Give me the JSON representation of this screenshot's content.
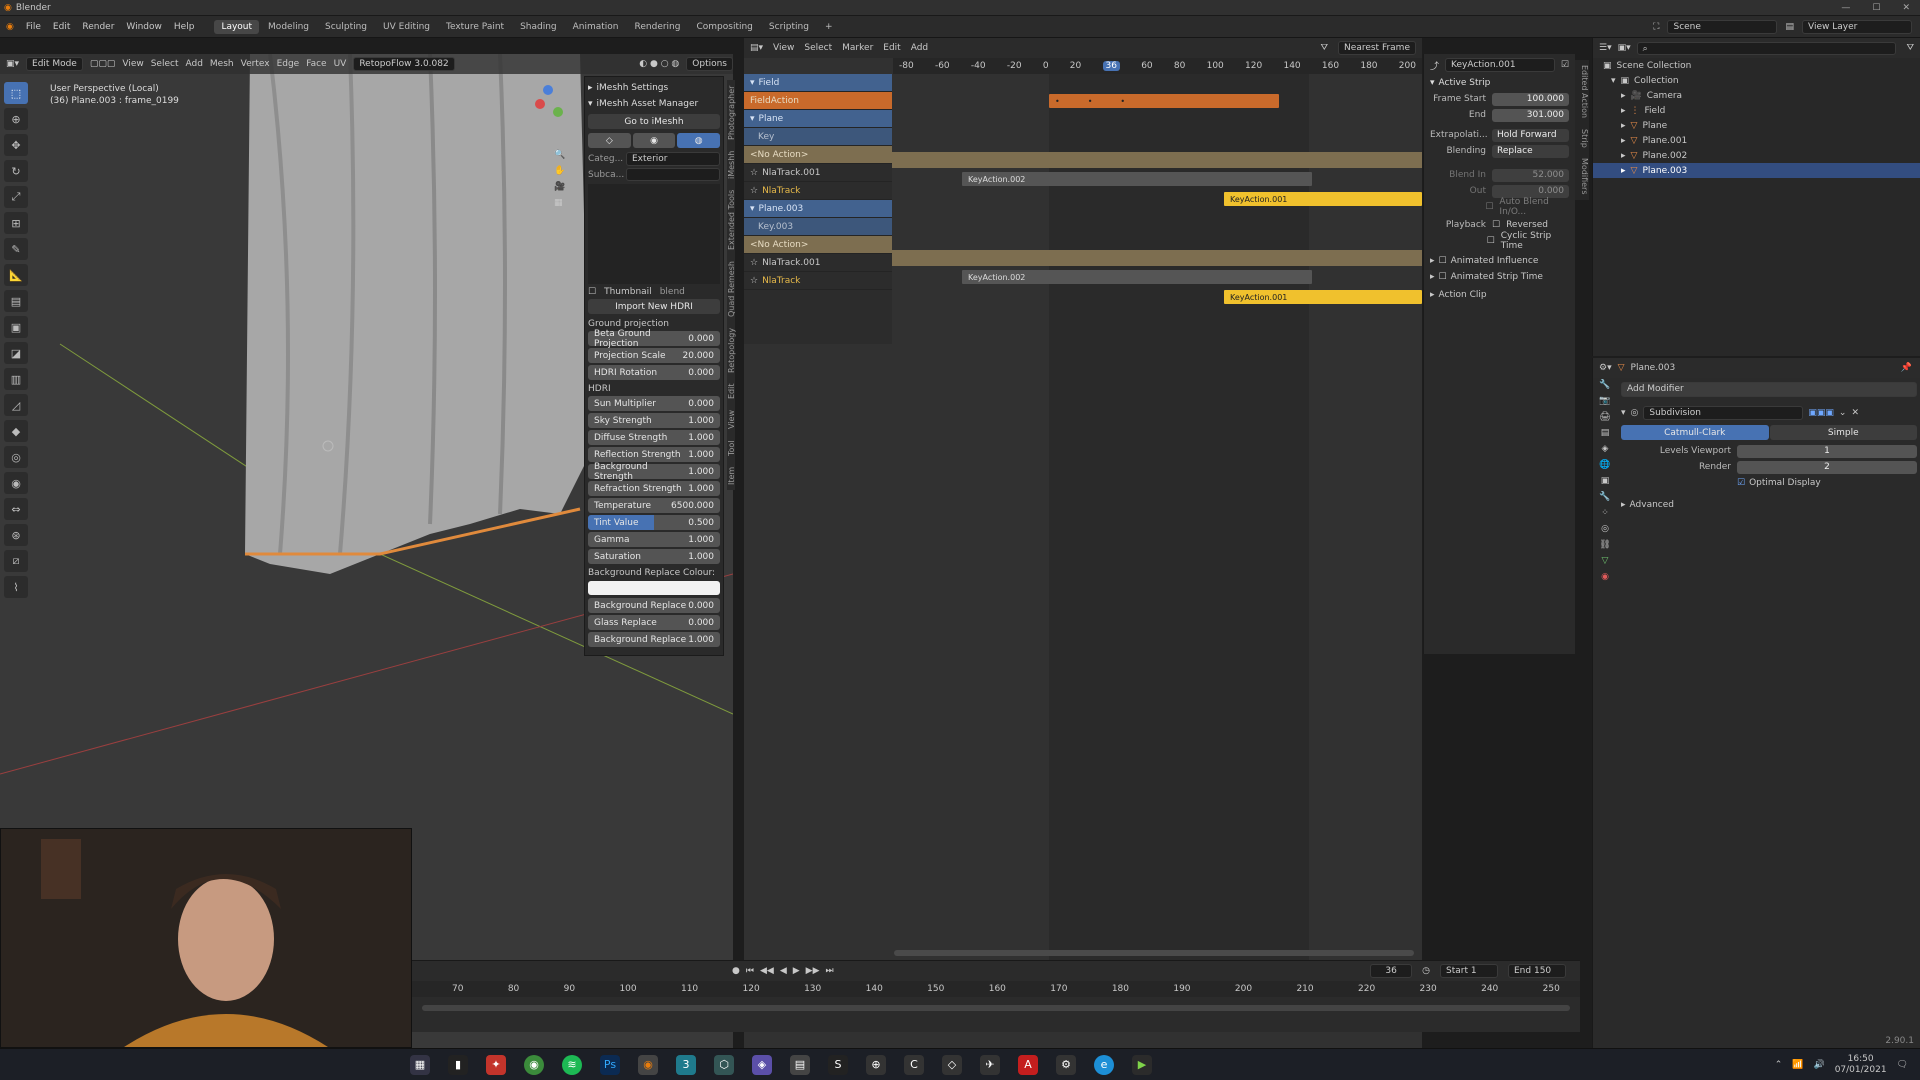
{
  "app": {
    "title": "Blender"
  },
  "menu": [
    "File",
    "Edit",
    "Render",
    "Window",
    "Help"
  ],
  "workspaces": [
    "Layout",
    "Modeling",
    "Sculpting",
    "UV Editing",
    "Texture Paint",
    "Shading",
    "Animation",
    "Rendering",
    "Compositing",
    "Scripting"
  ],
  "topright": {
    "scene": "Scene",
    "view_layer": "View Layer"
  },
  "viewport": {
    "mode": "Edit Mode",
    "menus": [
      "View",
      "Select",
      "Add",
      "Mesh",
      "Vertex",
      "Edge",
      "Face",
      "UV"
    ],
    "orientation": "Global",
    "addon": "RetopoFlow 3.0.082",
    "options": "Options",
    "overlay_title": "User Perspective (Local)",
    "overlay_sub": "(36) Plane.003 : frame_0199"
  },
  "imesh": {
    "settings": "iMeshh Settings",
    "asset_manager": "iMeshh Asset Manager",
    "goto": "Go to iMeshh",
    "category_label": "Categ...",
    "category": "Exterior",
    "subcategory_label": "Subca...",
    "thumbnail": "Thumbnail",
    "blend": "blend",
    "import": "Import New HDRI",
    "ground_heading": "Ground projection",
    "hdri_heading": "HDRI",
    "bg_replace_colour": "Background Replace Colour:",
    "fields_a": [
      {
        "label": "Beta Ground Projection",
        "value": "0.000"
      },
      {
        "label": "Projection Scale",
        "value": "20.000"
      },
      {
        "label": "HDRI Rotation",
        "value": "0.000"
      }
    ],
    "fields_b": [
      {
        "label": "Sun Multiplier",
        "value": "0.000"
      },
      {
        "label": "Sky Strength",
        "value": "1.000"
      },
      {
        "label": "Diffuse Strength",
        "value": "1.000"
      },
      {
        "label": "Reflection Strength",
        "value": "1.000"
      },
      {
        "label": "Background Strength",
        "value": "1.000"
      },
      {
        "label": "Refraction Strength",
        "value": "1.000"
      },
      {
        "label": "Temperature",
        "value": "6500.000"
      },
      {
        "label": "Tint Value",
        "value": "0.500"
      },
      {
        "label": "Gamma",
        "value": "1.000"
      },
      {
        "label": "Saturation",
        "value": "1.000"
      }
    ],
    "fields_c": [
      {
        "label": "Background Replace",
        "value": "0.000"
      },
      {
        "label": "Glass Replace",
        "value": "0.000"
      },
      {
        "label": "Background Replace",
        "value": "1.000"
      }
    ]
  },
  "side_tabs": [
    "Item",
    "Tool",
    "View",
    "Edit",
    "Retopology",
    "Quad Remesh",
    "Extended Tools",
    "iMeshh",
    "Photographer"
  ],
  "nla": {
    "menus": [
      "View",
      "Select",
      "Marker",
      "Edit",
      "Add"
    ],
    "snap": "Nearest Frame",
    "ruler": [
      "-80",
      "-60",
      "-40",
      "-20",
      "0",
      "20",
      "36",
      "60",
      "80",
      "100",
      "120",
      "140",
      "160",
      "180",
      "200"
    ],
    "tracks": [
      {
        "name": "Field",
        "kind": "obj"
      },
      {
        "name": "FieldAction",
        "kind": "act"
      },
      {
        "name": "Plane",
        "kind": "obj"
      },
      {
        "name": "Key",
        "kind": "sub"
      },
      {
        "name": "<No Action>",
        "kind": "act2"
      },
      {
        "name": "NlaTrack.001",
        "kind": "track"
      },
      {
        "name": "NlaTrack",
        "kind": "track"
      },
      {
        "name": "Plane.003",
        "kind": "obj"
      },
      {
        "name": "Key.003",
        "kind": "sub"
      },
      {
        "name": "<No Action>",
        "kind": "act2"
      },
      {
        "name": "NlaTrack.001",
        "kind": "track"
      },
      {
        "name": "NlaTrack",
        "kind": "track"
      }
    ],
    "strips": [
      "KeyAction.002",
      "KeyAction.001",
      "KeyAction.002",
      "KeyAction.001"
    ]
  },
  "strip_panel": {
    "name": "KeyAction.001",
    "heading": "Active Strip",
    "frame_start_label": "Frame Start",
    "frame_start": "100.000",
    "end_label": "End",
    "end": "301.000",
    "extrapolation_label": "Extrapolati...",
    "extrapolation": "Hold Forward",
    "blending_label": "Blending",
    "blending": "Replace",
    "blend_in_label": "Blend In",
    "blend_in": "52.000",
    "out_label": "Out",
    "out": "0.000",
    "auto_blend": "Auto Blend In/O...",
    "playback_label": "Playback",
    "reversed": "Reversed",
    "cyclic": "Cyclic Strip Time",
    "animated_influence": "Animated Influence",
    "animated_strip_time": "Animated Strip Time",
    "action_clip": "Action Clip",
    "tabs": [
      "Edited Action",
      "Strip",
      "Modifiers"
    ]
  },
  "outliner": {
    "items": [
      {
        "name": "Scene Collection",
        "indent": 0
      },
      {
        "name": "Collection",
        "indent": 1
      },
      {
        "name": "Camera",
        "indent": 2
      },
      {
        "name": "Field",
        "indent": 2
      },
      {
        "name": "Plane",
        "indent": 2
      },
      {
        "name": "Plane.001",
        "indent": 2
      },
      {
        "name": "Plane.002",
        "indent": 2
      },
      {
        "name": "Plane.003",
        "indent": 2,
        "selected": true
      }
    ]
  },
  "properties": {
    "object": "Plane.003",
    "add_modifier": "Add Modifier",
    "modifier": "Subdivision",
    "catmull": "Catmull-Clark",
    "simple": "Simple",
    "levels_label": "Levels Viewport",
    "levels": "1",
    "render_label": "Render",
    "render": "2",
    "optimal": "Optimal Display",
    "advanced": "Advanced"
  },
  "timeline": {
    "current": "36",
    "start_label": "Start",
    "start": "1",
    "end_label": "End",
    "end": "150",
    "ruler": [
      "70",
      "80",
      "90",
      "100",
      "110",
      "120",
      "130",
      "140",
      "150",
      "160",
      "170",
      "180",
      "190",
      "200",
      "210",
      "220",
      "230",
      "240",
      "250"
    ]
  },
  "version": "2.90.1",
  "clock": {
    "time": "16:50",
    "date": "07/01/2021"
  }
}
